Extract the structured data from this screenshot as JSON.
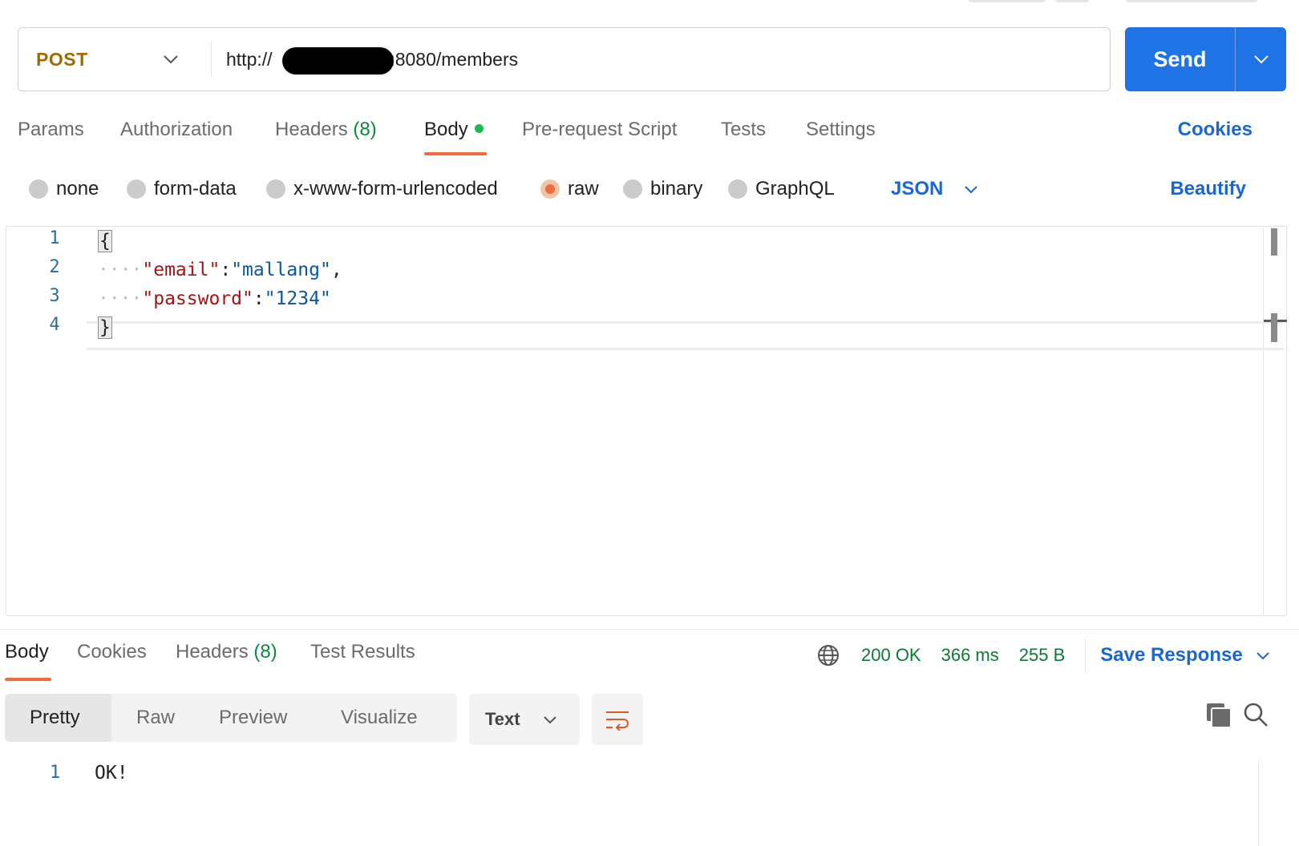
{
  "request": {
    "method": "POST",
    "url": "http://3██████████:8080/members",
    "url_prefix": "http://",
    "url_suffix": "4:8080/members",
    "send_label": "Send"
  },
  "request_tabs": {
    "params": "Params",
    "authorization": "Authorization",
    "headers": "Headers",
    "headers_count": "(8)",
    "body": "Body",
    "prerequest": "Pre-request Script",
    "tests": "Tests",
    "settings": "Settings",
    "cookies": "Cookies"
  },
  "body_types": {
    "none": "none",
    "form_data": "form-data",
    "urlencoded": "x-www-form-urlencoded",
    "raw": "raw",
    "binary": "binary",
    "graphql": "GraphQL",
    "selected": "raw",
    "language": "JSON",
    "beautify": "Beautify"
  },
  "editor": {
    "line_numbers": [
      "1",
      "2",
      "3",
      "4"
    ],
    "open_brace": "{",
    "close_brace": "}",
    "indent": "····",
    "fields": [
      {
        "key": "\"email\"",
        "colon": ":",
        "value": "\"mallang\"",
        "trail": ","
      },
      {
        "key": "\"password\"",
        "colon": ":",
        "value": "\"1234\"",
        "trail": ""
      }
    ]
  },
  "response_tabs": {
    "body": "Body",
    "cookies": "Cookies",
    "headers": "Headers",
    "headers_count": "(8)",
    "test_results": "Test Results"
  },
  "response_status": {
    "status": "200 OK",
    "time": "366 ms",
    "size": "255 B",
    "save_label": "Save Response"
  },
  "response_view": {
    "modes": [
      "Pretty",
      "Raw",
      "Preview",
      "Visualize"
    ],
    "active_mode": "Pretty",
    "format": "Text"
  },
  "response_body": {
    "line_numbers": [
      "1"
    ],
    "lines": [
      "OK!"
    ]
  },
  "colors": {
    "accent_orange": "#f26b3a",
    "link_blue": "#1a66d2",
    "send_blue": "#1f73e6",
    "status_green": "#0a7a35",
    "method_gold": "#a06a00"
  },
  "icons": {
    "method_dropdown": "chevron-down-icon",
    "send_dropdown": "chevron-down-icon",
    "network": "globe-icon",
    "wrap": "wrap-lines-icon",
    "copy": "copy-icon",
    "search": "search-icon"
  }
}
